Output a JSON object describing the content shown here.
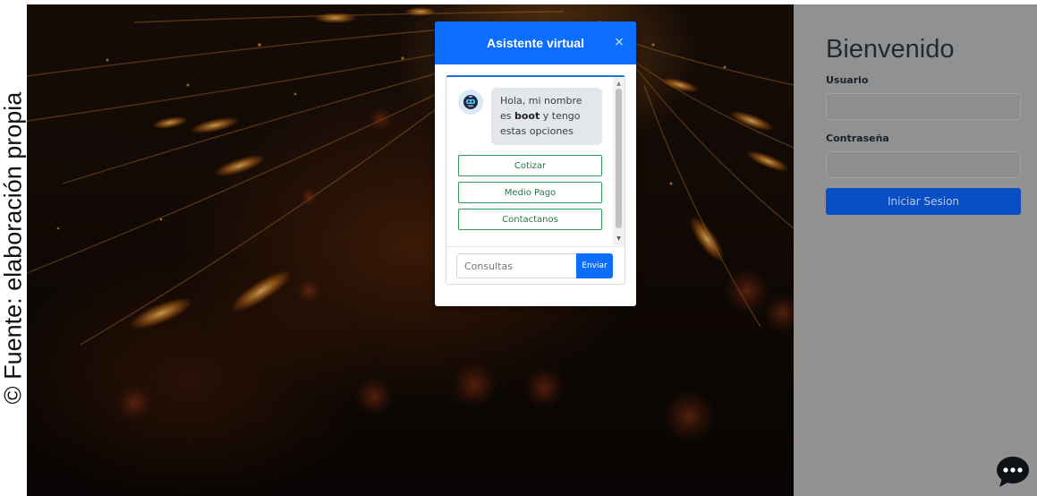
{
  "caption": "© Fuente: elaboración propia",
  "login": {
    "title": "Bienvenido",
    "username_label": "Usuario",
    "password_label": "Contraseña",
    "username_value": "",
    "password_value": "",
    "submit_label": "Iniciar Sesion"
  },
  "modal": {
    "title": "Asistente virtual",
    "close_glyph": "×",
    "bot_message": {
      "prefix": "Hola, mi nombre es ",
      "bot_name": "boot",
      "suffix": " y tengo estas opciones"
    },
    "options": [
      "Cotizar",
      "Medio Pago",
      "Contactanos"
    ],
    "input_placeholder": "Consultas",
    "input_value": "",
    "send_label": "Enviar"
  },
  "icons": {
    "chat_fab": "chat-bubble-icon",
    "bot_avatar": "robot-icon",
    "close": "close-icon"
  },
  "colors": {
    "primary": "#0d6efd",
    "option_border": "#2e9a5a",
    "login_button": "#0a4ec5",
    "right_panel": "#919191"
  }
}
